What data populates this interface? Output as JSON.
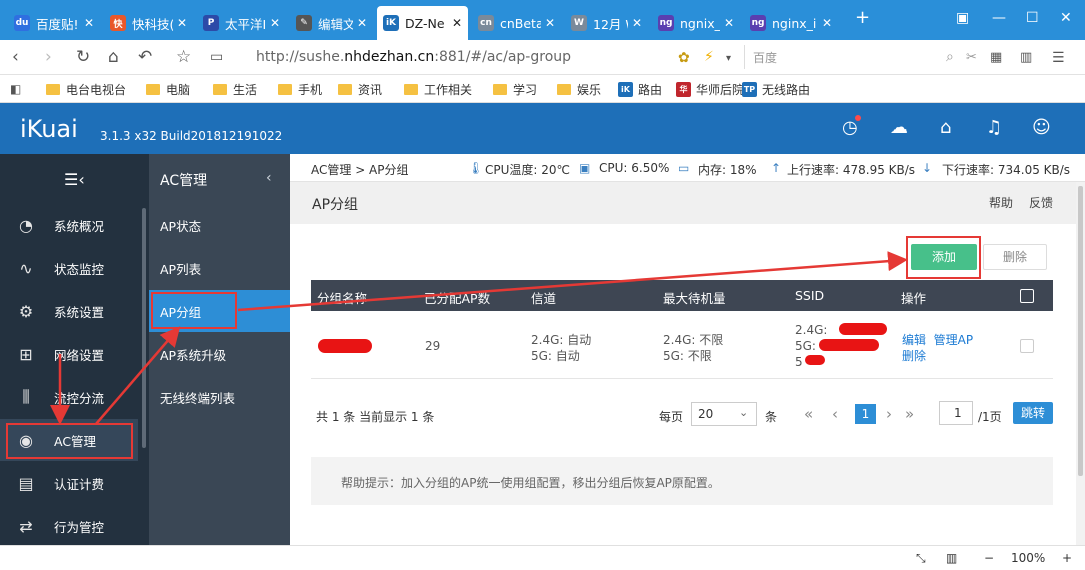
{
  "browser": {
    "tabs": [
      {
        "label": "百度贴!",
        "icon": "baidu-icon",
        "color": "#2f6fe0",
        "glyph": "du"
      },
      {
        "label": "快科技(",
        "icon": "kuai-icon",
        "color": "#e8572a",
        "glyph": "快"
      },
      {
        "label": "太平洋I",
        "icon": "pconline-icon",
        "color": "#2c4aa8",
        "glyph": "P"
      },
      {
        "label": "编辑文",
        "icon": "edit-icon",
        "color": "#555555",
        "glyph": "✎"
      },
      {
        "label": "DZ-Ne",
        "icon": "ikuai-icon",
        "color": "#1e6fb8",
        "glyph": "iK"
      },
      {
        "label": "cnBeta",
        "icon": "cnbeta-icon",
        "color": "#7a8a9a",
        "glyph": "cn"
      },
      {
        "label": "12月 W",
        "icon": "windows-icon",
        "color": "#7a8a9a",
        "glyph": "W"
      },
      {
        "label": "ngnix_i",
        "icon": "nginx-icon",
        "color": "#5a3fb0",
        "glyph": "ng"
      },
      {
        "label": "nginx_i",
        "icon": "nginx-icon",
        "color": "#5a3fb0",
        "glyph": "ng"
      }
    ],
    "url_prefix": "http://sushe.",
    "url_domain": "nhdezhan.cn",
    "url_suffix": ":881/#/ac/ap-group",
    "search_placeholder": "百度",
    "bookmarks": [
      {
        "label": "电台电视台",
        "type": "folder"
      },
      {
        "label": "电脑",
        "type": "folder"
      },
      {
        "label": "生活",
        "type": "folder"
      },
      {
        "label": "手机",
        "type": "folder"
      },
      {
        "label": "资讯",
        "type": "folder"
      },
      {
        "label": "工作相关",
        "type": "folder"
      },
      {
        "label": "学习",
        "type": "folder"
      },
      {
        "label": "娱乐",
        "type": "folder"
      },
      {
        "label": "路由",
        "type": "site",
        "color": "#1e6fb8",
        "glyph": "iK"
      },
      {
        "label": "华师后院",
        "type": "site",
        "color": "#c0262d",
        "glyph": "华"
      },
      {
        "label": "无线路由",
        "type": "site",
        "color": "#1e6fb8",
        "glyph": "TP"
      }
    ],
    "zoom": "100%"
  },
  "header": {
    "logo": "iKuai",
    "version": "3.1.3 x32 Build201812191022"
  },
  "sidebar": {
    "items": [
      {
        "label": "系统概况",
        "icon": "dashboard-icon",
        "glyph": "◔"
      },
      {
        "label": "状态监控",
        "icon": "monitor-icon",
        "glyph": "∿"
      },
      {
        "label": "系统设置",
        "icon": "settings-icon",
        "glyph": "⚙"
      },
      {
        "label": "网络设置",
        "icon": "network-icon",
        "glyph": "⊞"
      },
      {
        "label": "流控分流",
        "icon": "flow-control-icon",
        "glyph": "⫼"
      },
      {
        "label": "AC管理",
        "icon": "wifi-ac-icon",
        "glyph": "◉"
      },
      {
        "label": "认证计费",
        "icon": "auth-billing-icon",
        "glyph": "▤"
      },
      {
        "label": "行为管控",
        "icon": "behavior-control-icon",
        "glyph": "⇄"
      }
    ]
  },
  "subnav": {
    "title": "AC管理",
    "items": [
      "AP状态",
      "AP列表",
      "AP分组",
      "AP系统升级",
      "无线终端列表"
    ]
  },
  "statusbar": {
    "breadcrumb": "AC管理 > AP分组",
    "cpu_temp": "CPU温度: 20℃",
    "cpu": "CPU: 6.50%",
    "mem": "内存: 18%",
    "up": "上行速率: 478.95 KB/s",
    "down": "下行速率: 734.05 KB/s"
  },
  "page": {
    "title": "AP分组",
    "help": "帮助",
    "feedback": "反馈",
    "add_btn": "添加",
    "del_btn": "删除",
    "columns": [
      "分组名称",
      "已分配AP数",
      "信道",
      "最大待机量",
      "SSID",
      "操作"
    ],
    "rows": [
      {
        "name": "",
        "ap_count": "29",
        "channel_24": "2.4G: 自动",
        "channel_5": "5G: 自动",
        "max_24": "2.4G: 不限",
        "max_5": "5G: 不限",
        "ssid_24": "2.4G:",
        "ssid_5": "5G:",
        "ssid_5b": "5",
        "op_edit": "编辑",
        "op_manage": "管理AP",
        "op_delete": "删除"
      }
    ],
    "total": "共 1 条 当前显示 1 条",
    "per_page_label": "每页",
    "per_page_value": "20",
    "per_page_unit": "条",
    "current_page": "1",
    "page_input": "1",
    "page_total": "/1页",
    "jump": "跳转",
    "tip": "帮助提示：加入分组的AP统一使用组配置，移出分组后恢复AP原配置。"
  }
}
